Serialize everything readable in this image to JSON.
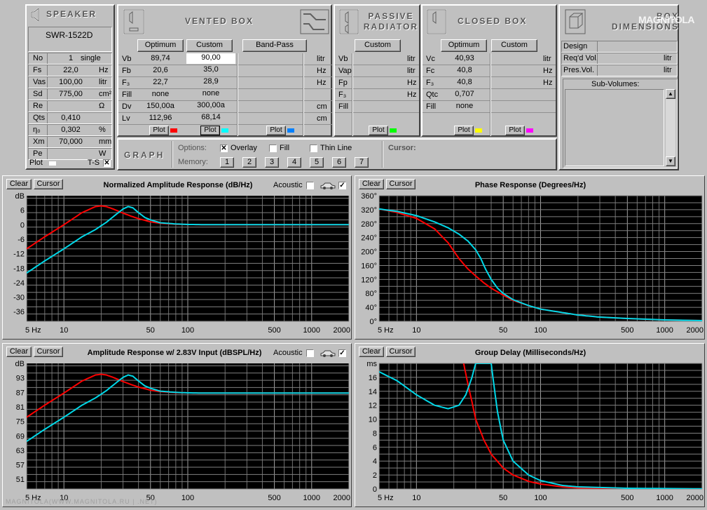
{
  "speaker": {
    "header": "SPEAKER",
    "model": "SWR-1522D",
    "rows": [
      {
        "label": "No",
        "value": "1",
        "extra": "single"
      },
      {
        "label": "Fs",
        "value": "22,0",
        "unit": "Hz"
      },
      {
        "label": "Vas",
        "value": "100,00",
        "unit": "litr"
      },
      {
        "label": "Sd",
        "value": "775,00",
        "unit": "cm²"
      },
      {
        "label": "Re",
        "value": "",
        "unit": "Ω"
      },
      {
        "label": "Qts",
        "value": "0,410",
        "unit": ""
      },
      {
        "label": "η₀",
        "value": "0,302",
        "unit": "%"
      },
      {
        "label": "Xm",
        "value": "70,000",
        "unit": "mm"
      },
      {
        "label": "Pe",
        "value": "",
        "unit": "W"
      }
    ],
    "plot_label": "Plot",
    "ts_label": "T-S",
    "ts_checked": "✕"
  },
  "vented": {
    "header": "VENTED BOX",
    "btn_optimum": "Optimum",
    "btn_custom": "Custom",
    "btn_bandpass": "Band-Pass",
    "labels": [
      "Vb",
      "Fb",
      "F₃",
      "Fill",
      "Dv",
      "Lv"
    ],
    "optimum": [
      "89,74",
      "20,6",
      "22,7",
      "none",
      "150,00a",
      "112,96"
    ],
    "custom": [
      "90,00",
      "35,0",
      "28,9",
      "none",
      "300,00a",
      "68,14"
    ],
    "units": [
      "litr",
      "Hz",
      "Hz",
      "",
      "cm",
      "cm"
    ],
    "plot_label": "Plot",
    "colors": {
      "optimum": "#ff0000",
      "custom": "#00ffff",
      "bandpass": "#0080ff"
    }
  },
  "passive": {
    "header": "PASSIVE RADIATOR",
    "btn_custom": "Custom",
    "labels": [
      "Vb",
      "Vap",
      "Fp",
      "F₃",
      "Fill"
    ],
    "units": [
      "litr",
      "litr",
      "Hz",
      "Hz",
      ""
    ],
    "plot_label": "Plot",
    "color": "#00ff00"
  },
  "closed": {
    "header": "CLOSED BOX",
    "btn_optimum": "Optimum",
    "btn_custom": "Custom",
    "labels": [
      "Vc",
      "Fc",
      "F₃",
      "Qtc",
      "Fill"
    ],
    "optimum": [
      "40,93",
      "40,8",
      "40,8",
      "0,707",
      "none"
    ],
    "units": [
      "litr",
      "Hz",
      "Hz",
      "",
      ""
    ],
    "plot_label": "Plot",
    "colors": {
      "optimum": "#ffff00",
      "custom": "#ff00ff"
    }
  },
  "box_dims": {
    "header": "BOX DIMENSIONS",
    "rows": [
      {
        "label": "Design",
        "unit": ""
      },
      {
        "label": "Req'd Vol.",
        "unit": "litr"
      },
      {
        "label": "Pres.Vol.",
        "unit": "litr"
      }
    ],
    "subvolumes_label": "Sub-Volumes:"
  },
  "graph": {
    "header": "GRAPH",
    "options_label": "Options:",
    "overlay_label": "Overlay",
    "overlay_checked": "✕",
    "fill_label": "Fill",
    "thinline_label": "Thin Line",
    "memory_label": "Memory:",
    "memory": [
      "1",
      "2",
      "3",
      "4",
      "5",
      "6",
      "7"
    ],
    "cursor_label": "Cursor:"
  },
  "chart_buttons": {
    "clear": "Clear",
    "cursor": "Cursor"
  },
  "acoustic_label": "Acoustic",
  "watermark": "MAGNITOLA",
  "footer_watermark": "MAGNITOLA(WWW.MAGNITOLA.RU | .NET)",
  "chart_data": [
    {
      "type": "line",
      "title": "Normalized Amplitude Response (dB/Hz)",
      "unit_label": "dB",
      "x_scale": "log",
      "xlim": [
        5,
        2000
      ],
      "ylim": [
        -40,
        12
      ],
      "yticks": [
        12,
        6,
        0,
        -6,
        -12,
        -18,
        -24,
        -30,
        -36
      ],
      "ytick_labels": [
        "dB",
        "6",
        "0",
        "-6",
        "-12",
        "-18",
        "-24",
        "-30",
        "-36"
      ],
      "xticks": [
        5,
        10,
        50,
        100,
        500,
        1000,
        2000
      ],
      "xtick_labels": [
        "5 Hz",
        "10",
        "50",
        "100",
        "500",
        "1000",
        "2000"
      ],
      "grid": true,
      "series": [
        {
          "color": "#ff0000",
          "x": [
            5,
            7,
            10,
            14,
            18,
            20,
            22,
            25,
            30,
            35,
            40,
            50,
            60,
            80,
            100,
            150,
            200,
            500,
            2000
          ],
          "y": [
            -10,
            -5,
            0,
            5,
            7.5,
            7.8,
            7.5,
            6.5,
            4.8,
            3.5,
            2.5,
            1.2,
            0.6,
            0.2,
            0.1,
            0,
            0,
            0,
            0
          ]
        },
        {
          "color": "#00d8e8",
          "x": [
            5,
            7,
            10,
            14,
            18,
            22,
            26,
            30,
            33,
            36,
            40,
            45,
            50,
            60,
            80,
            100,
            150,
            200,
            500,
            2000
          ],
          "y": [
            -20,
            -15,
            -10,
            -5,
            -2,
            1,
            4,
            6.5,
            7.5,
            7,
            5,
            3,
            2,
            0.8,
            0.3,
            0.1,
            0,
            0,
            0,
            0
          ]
        }
      ]
    },
    {
      "type": "line",
      "title": "Phase Response (Degrees/Hz)",
      "x_scale": "log",
      "xlim": [
        5,
        2000
      ],
      "ylim": [
        0,
        360
      ],
      "yticks": [
        360,
        320,
        280,
        240,
        200,
        160,
        120,
        80,
        40,
        0
      ],
      "ytick_labels": [
        "360°",
        "320°",
        "280°",
        "240°",
        "200°",
        "160°",
        "120°",
        "80°",
        "40°",
        "0°"
      ],
      "xticks": [
        5,
        10,
        50,
        100,
        500,
        1000,
        2000
      ],
      "xtick_labels": [
        "5 Hz",
        "10",
        "50",
        "100",
        "500",
        "1000",
        "2000"
      ],
      "grid": true,
      "series": [
        {
          "color": "#ff0000",
          "x": [
            5,
            7,
            10,
            14,
            18,
            22,
            26,
            30,
            35,
            40,
            50,
            60,
            80,
            100,
            150,
            200,
            300,
            500,
            1000,
            2000
          ],
          "y": [
            322,
            312,
            295,
            265,
            225,
            180,
            150,
            130,
            110,
            95,
            75,
            60,
            45,
            35,
            25,
            18,
            12,
            8,
            4,
            2
          ]
        },
        {
          "color": "#00d8e8",
          "x": [
            5,
            7,
            10,
            14,
            18,
            22,
            26,
            30,
            33,
            36,
            40,
            45,
            50,
            60,
            80,
            100,
            150,
            200,
            300,
            500,
            1000,
            2000
          ],
          "y": [
            322,
            315,
            303,
            285,
            268,
            250,
            230,
            205,
            180,
            150,
            120,
            95,
            80,
            62,
            45,
            35,
            25,
            18,
            12,
            8,
            4,
            2
          ]
        }
      ]
    },
    {
      "type": "line",
      "title": "Amplitude Response w/ 2.83V Input (dBSPL/Hz)",
      "unit_label": "dB",
      "x_scale": "log",
      "xlim": [
        5,
        2000
      ],
      "ylim": [
        47,
        99
      ],
      "yticks": [
        99,
        93,
        87,
        81,
        75,
        69,
        63,
        57,
        51
      ],
      "ytick_labels": [
        "dB",
        "93",
        "87",
        "81",
        "75",
        "69",
        "63",
        "57",
        "51"
      ],
      "xticks": [
        5,
        10,
        50,
        100,
        500,
        1000,
        2000
      ],
      "xtick_labels": [
        "5 Hz",
        "10",
        "50",
        "100",
        "500",
        "1000",
        "2000"
      ],
      "grid": true,
      "series": [
        {
          "color": "#ff0000",
          "x": [
            5,
            7,
            10,
            14,
            18,
            20,
            22,
            25,
            30,
            35,
            40,
            50,
            60,
            80,
            100,
            150,
            200,
            500,
            2000
          ],
          "y": [
            76.7,
            81.7,
            86.7,
            91.7,
            94.2,
            94.5,
            94.2,
            93.2,
            91.5,
            90.2,
            89.2,
            87.9,
            87.3,
            86.9,
            86.8,
            86.7,
            86.7,
            86.7,
            86.7
          ]
        },
        {
          "color": "#00d8e8",
          "x": [
            5,
            7,
            10,
            14,
            18,
            22,
            26,
            30,
            33,
            36,
            40,
            45,
            50,
            60,
            80,
            100,
            150,
            200,
            500,
            2000
          ],
          "y": [
            66.7,
            71.7,
            76.7,
            81.7,
            84.7,
            87.7,
            90.7,
            93.2,
            94.2,
            93.7,
            91.7,
            89.7,
            88.7,
            87.5,
            87,
            86.8,
            86.7,
            86.7,
            86.7,
            86.7
          ]
        }
      ]
    },
    {
      "type": "line",
      "title": "Group Delay (Milliseconds/Hz)",
      "unit_label": "ms",
      "x_scale": "log",
      "xlim": [
        5,
        2000
      ],
      "ylim": [
        0,
        18
      ],
      "yticks": [
        18,
        16,
        14,
        12,
        10,
        8,
        6,
        4,
        2,
        0
      ],
      "ytick_labels": [
        "ms",
        "16",
        "14",
        "12",
        "10",
        "8",
        "6",
        "4",
        "2",
        "0"
      ],
      "xticks": [
        5,
        10,
        50,
        100,
        500,
        1000,
        2000
      ],
      "xtick_labels": [
        "5 Hz",
        "10",
        "50",
        "100",
        "500",
        "1000",
        "2000"
      ],
      "grid": true,
      "series": [
        {
          "color": "#ff0000",
          "x": [
            24,
            26,
            28,
            30,
            35,
            40,
            50,
            60,
            80,
            100,
            150,
            200,
            500,
            2000
          ],
          "y": [
            18,
            15,
            12.5,
            10,
            7,
            5,
            3,
            2,
            1.1,
            0.7,
            0.3,
            0.15,
            0.05,
            0.01
          ]
        },
        {
          "color": "#00d8e8",
          "x": [
            5,
            7,
            10,
            14,
            18,
            22,
            25,
            28,
            30,
            31,
            40,
            42,
            45,
            50,
            60,
            80,
            100,
            150,
            200,
            500,
            2000
          ],
          "y": [
            16.8,
            15.5,
            13.5,
            12,
            11.5,
            12,
            13.5,
            16,
            18,
            18,
            18,
            15,
            11,
            7,
            4,
            2,
            1.2,
            0.5,
            0.3,
            0.1,
            0.02
          ]
        }
      ]
    }
  ]
}
